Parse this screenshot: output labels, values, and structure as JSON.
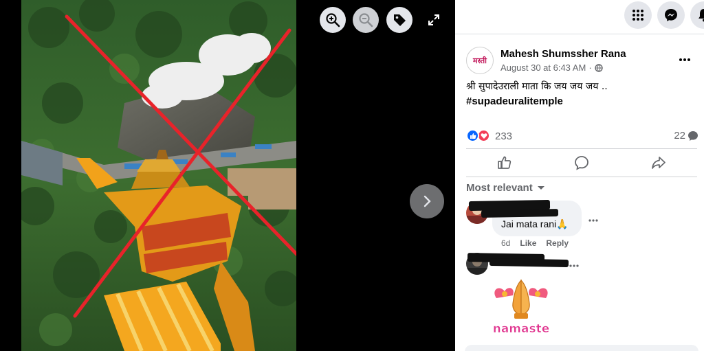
{
  "viewer": {
    "icons": {
      "zoom_in": "zoom-in-icon",
      "zoom_out": "zoom-out-icon",
      "tag": "tag-icon",
      "fullscreen": "fullscreen-icon",
      "next": "chevron-right-icon"
    },
    "overlay": "red-x-cross"
  },
  "topbar": {
    "icons": [
      "menu-grid-icon",
      "messenger-icon",
      "notifications-bell-icon"
    ]
  },
  "post": {
    "author": "Mahesh Shumssher Rana",
    "avatar_text": "मस्ती",
    "timestamp": "August 30 at 6:43 AM",
    "audience_icon": "globe-icon",
    "text_line1": "श्री सुपादेउराली माता कि जय जय जय ..",
    "hashtag": "#supadeuralitemple",
    "reaction_count": "233",
    "comment_count": "22",
    "reactions": [
      "like",
      "love"
    ]
  },
  "actions": {
    "icons": [
      "like-icon",
      "comment-icon",
      "share-icon"
    ]
  },
  "comments": {
    "sort_label": "Most relevant",
    "items": [
      {
        "author": "",
        "text": "Jai mata rani🙏",
        "age": "6d",
        "like_label": "Like",
        "reply_label": "Reply"
      },
      {
        "author": "",
        "sticker_text": "namaste"
      }
    ]
  },
  "colors": {
    "facebook_blue": "#0866ff",
    "love_red": "#f33e58",
    "overlay_red": "#e8232a",
    "panel_bg": "#ffffff",
    "bubble_bg": "#f0f2f5"
  }
}
